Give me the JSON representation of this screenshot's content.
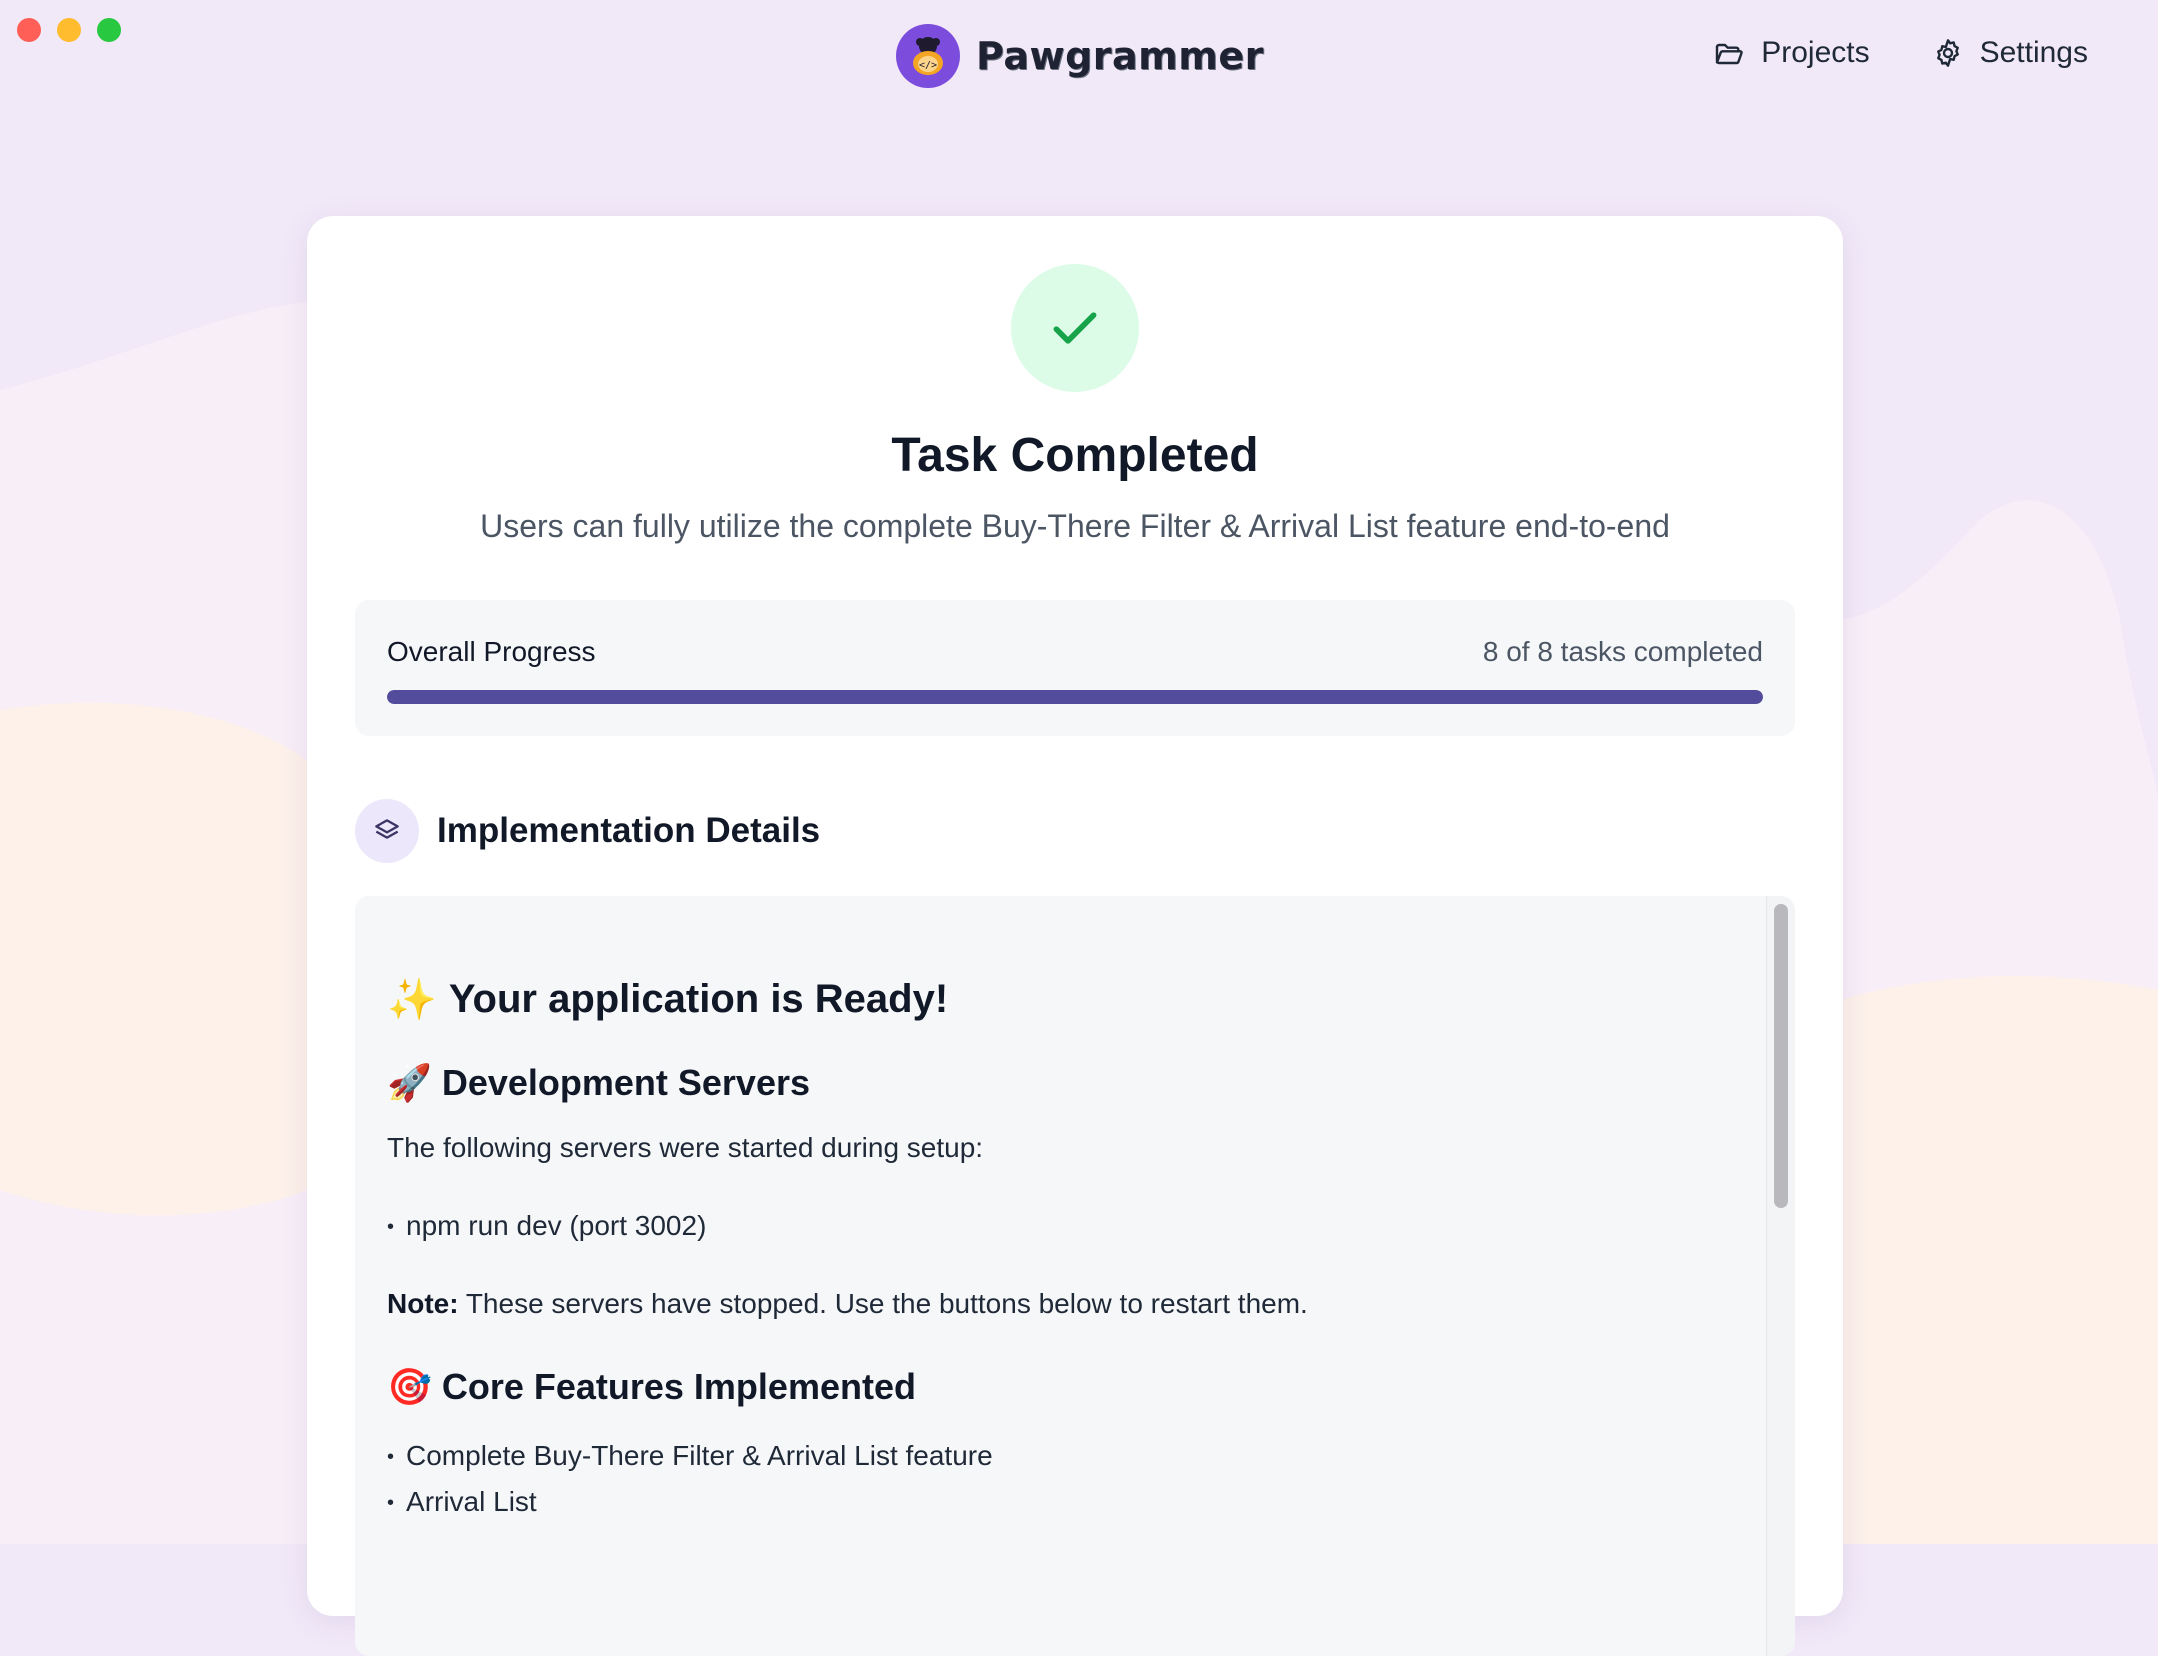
{
  "header": {
    "brand_name": "Pawgrammer",
    "nav": [
      {
        "label": "Projects",
        "icon": "folder-icon"
      },
      {
        "label": "Settings",
        "icon": "gear-icon"
      }
    ]
  },
  "card": {
    "status_icon": "checkmark-icon",
    "title": "Task Completed",
    "subtitle": "Users can fully utilize the complete Buy-There Filter & Arrival List feature end-to-end",
    "progress": {
      "label": "Overall Progress",
      "count_text": "8 of 8 tasks completed",
      "completed": 8,
      "total": 8,
      "fraction": 1.0
    },
    "section": {
      "icon": "layers-icon",
      "title": "Implementation Details"
    },
    "details": {
      "h1": "Your application is Ready!",
      "h1_emoji": "✨",
      "dev_servers": {
        "emoji": "🚀",
        "title": "Development Servers",
        "intro": "The following servers were started during setup:",
        "items": [
          "npm run dev (port 3002)"
        ],
        "note_label": "Note:",
        "note_text": "These servers have stopped. Use the buttons below to restart them."
      },
      "core_features": {
        "emoji": "🎯",
        "title": "Core Features Implemented",
        "items": [
          "Complete Buy-There Filter & Arrival List feature",
          "Arrival List"
        ]
      }
    }
  },
  "colors": {
    "background": "#f1e9f8",
    "accent": "#534b9b",
    "success_bg": "#dcfce7",
    "success": "#16a34a",
    "brand": "#7c4ddc"
  }
}
